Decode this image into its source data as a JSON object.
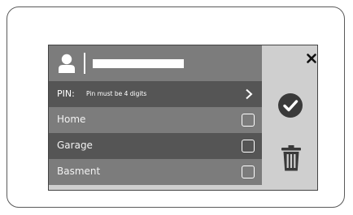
{
  "user": {
    "name_value": "",
    "icons": {
      "avatar": "user-avatar-icon"
    }
  },
  "pin": {
    "label": "PIN:",
    "hint": "Pin must be 4 digits",
    "icon": "chevron-right-icon"
  },
  "zones": [
    {
      "label": "Home",
      "checked": false
    },
    {
      "label": "Garage",
      "checked": false
    },
    {
      "label": "Basment",
      "checked": false
    }
  ],
  "actions": {
    "close_icon": "close-icon",
    "confirm_icon": "check-circle-icon",
    "delete_icon": "trash-icon"
  },
  "colors": {
    "row_light": "#7c7c7c",
    "row_dark": "#555555",
    "side_panel": "#cfcfcf",
    "icon_dark": "#3a3a3a"
  }
}
